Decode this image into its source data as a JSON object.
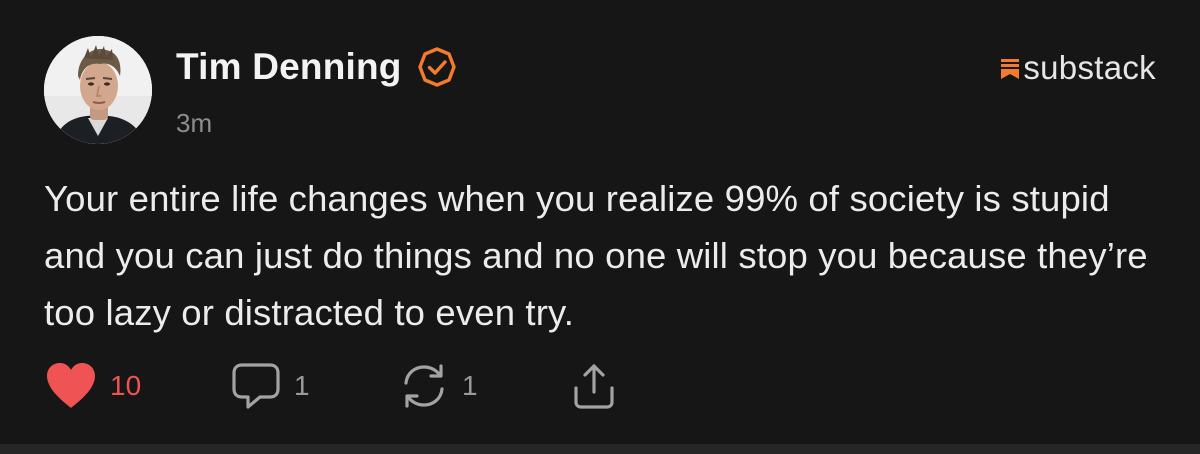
{
  "author": {
    "name": "Tim Denning",
    "verified": true,
    "timestamp": "3m"
  },
  "brand": {
    "name": "substack",
    "color": "#f47b2c"
  },
  "post": {
    "text": "Your entire life changes when you realize 99% of society is stupid and you can just do things and no one will stop you because they’re too lazy or distracted to even try."
  },
  "actions": {
    "like": {
      "icon": "heart-icon",
      "count": "10",
      "liked": true,
      "color": "#ef5354"
    },
    "comment": {
      "icon": "comment-icon",
      "count": "1"
    },
    "restack": {
      "icon": "restack-icon",
      "count": "1"
    },
    "share": {
      "icon": "share-icon"
    }
  },
  "colors": {
    "background": "#161616",
    "accent": "#f47b2c",
    "muted": "#8d8d8d"
  }
}
